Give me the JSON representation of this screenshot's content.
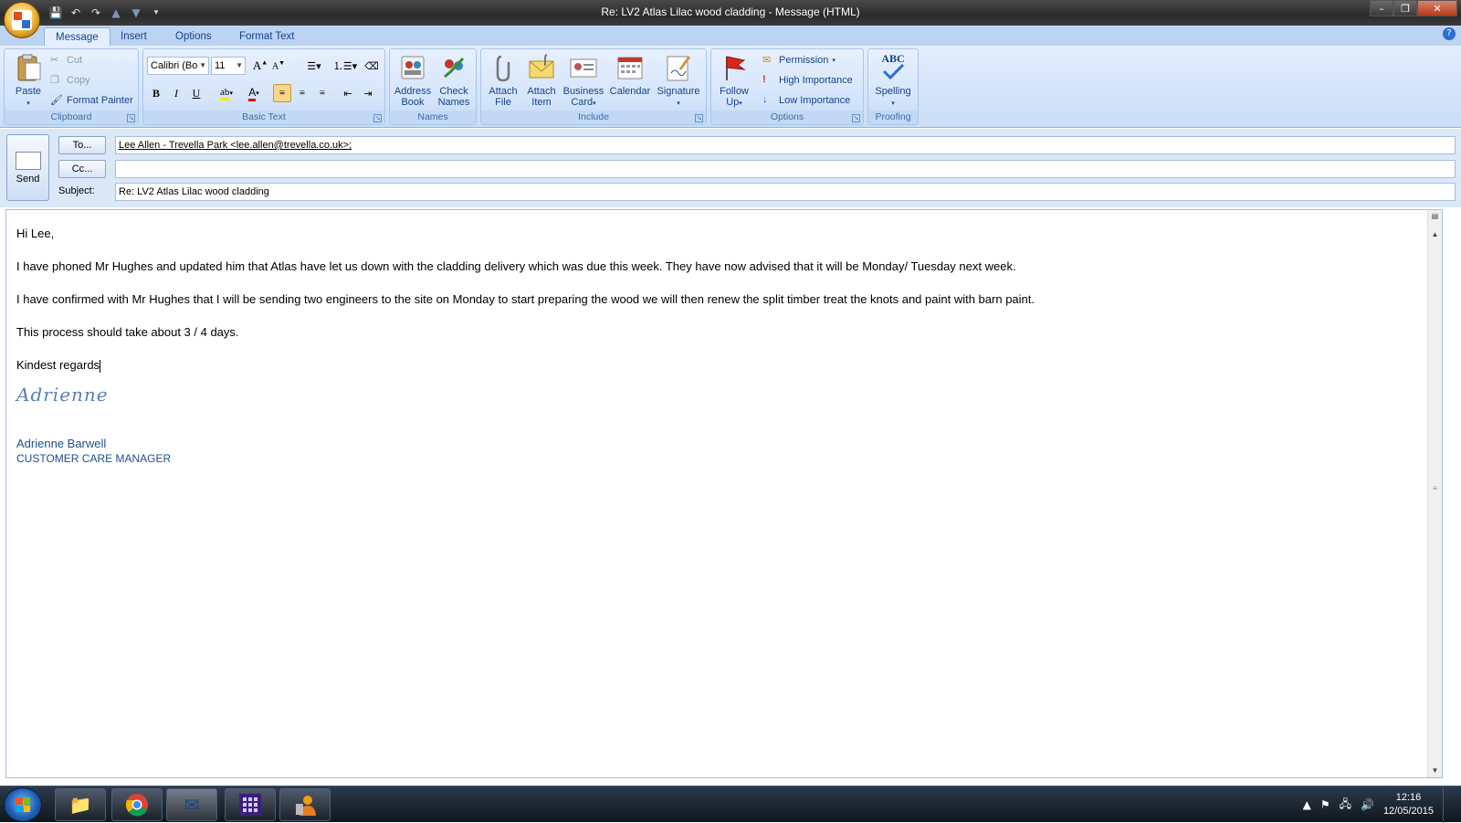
{
  "window": {
    "title": "Re: LV2 Atlas Lilac wood cladding - Message (HTML)",
    "minimize": "–",
    "restore": "❐",
    "close": "✕"
  },
  "tabs": [
    "Message",
    "Insert",
    "Options",
    "Format Text"
  ],
  "ribbon": {
    "clipboard": {
      "label": "Clipboard",
      "paste": "Paste",
      "cut": "Cut",
      "copy": "Copy",
      "format_painter": "Format Painter"
    },
    "basic_text": {
      "label": "Basic Text",
      "font": "Calibri (Bo",
      "size": "11",
      "bold": "B",
      "italic": "I",
      "underline": "U"
    },
    "names": {
      "label": "Names",
      "address_book": [
        "Address",
        "Book"
      ],
      "check_names": [
        "Check",
        "Names"
      ]
    },
    "include": {
      "label": "Include",
      "attach_file": [
        "Attach",
        "File"
      ],
      "attach_item": [
        "Attach",
        "Item"
      ],
      "business_card": [
        "Business",
        "Card"
      ],
      "calendar": "Calendar",
      "signature": "Signature"
    },
    "options": {
      "label": "Options",
      "follow_up": [
        "Follow",
        "Up"
      ],
      "permission": "Permission",
      "high_importance": "High Importance",
      "low_importance": "Low Importance"
    },
    "proofing": {
      "label": "Proofing",
      "spelling": "Spelling",
      "spelling_icon_text": "ABC"
    }
  },
  "compose": {
    "send": "Send",
    "to_button": "To...",
    "cc_button": "Cc...",
    "subject_label": "Subject:",
    "to_value": "Lee Allen - Trevella Park <lee.allen@trevella.co.uk>;",
    "cc_value": "",
    "subject_value": "Re: LV2 Atlas Lilac wood cladding"
  },
  "body": {
    "greeting": "Hi Lee,",
    "para1": "I have phoned Mr Hughes and updated him that Atlas have let us down with the cladding delivery which was due this week.  They have now advised that it will be Monday/ Tuesday next week.",
    "para2": "I have confirmed with Mr Hughes that I will be sending two engineers to the site on Monday to start preparing the wood  we will then renew the split timber treat the knots and paint with barn paint.",
    "para3": "This process should take about 3 / 4 days.",
    "closing": "Kindest regards",
    "signature_script": "Adrienne",
    "signature_name": "Adrienne Barwell",
    "signature_role": "CUSTOMER CARE MANAGER"
  },
  "taskbar": {
    "time": "12:16",
    "date": "12/05/2015"
  },
  "colors": {
    "ribbon_text": "#15428b",
    "signature_blue": "#1f4f8f",
    "highlight_orange": "#f8d78a"
  }
}
